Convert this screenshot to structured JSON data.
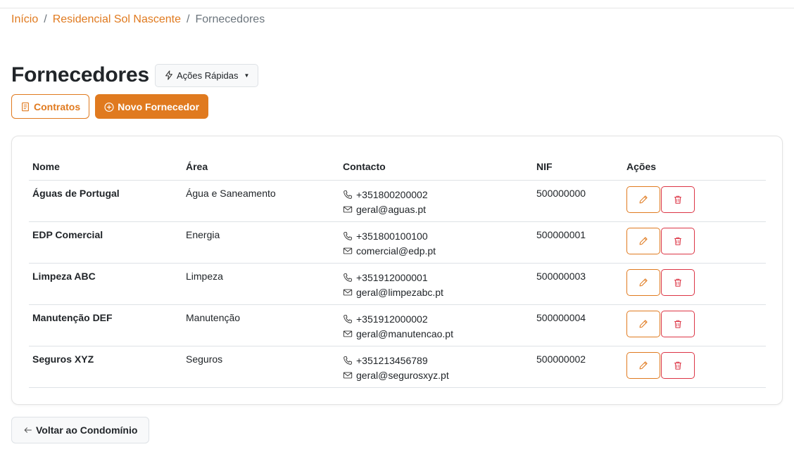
{
  "breadcrumb": {
    "home": "Início",
    "condo": "Residencial Sol Nascente",
    "current": "Fornecedores",
    "separator": "/"
  },
  "page": {
    "title": "Fornecedores",
    "quick_actions_label": "Ações Rápidas"
  },
  "toolbar": {
    "contracts_label": "Contratos",
    "new_supplier_label": "Novo Fornecedor"
  },
  "table": {
    "headers": {
      "name": "Nome",
      "area": "Área",
      "contact": "Contacto",
      "nif": "NIF",
      "actions": "Ações"
    },
    "rows": [
      {
        "name": "Águas de Portugal",
        "area": "Água e Saneamento",
        "phone": "+351800200002",
        "email": "geral@aguas.pt",
        "nif": "500000000"
      },
      {
        "name": "EDP Comercial",
        "area": "Energia",
        "phone": "+351800100100",
        "email": "comercial@edp.pt",
        "nif": "500000001"
      },
      {
        "name": "Limpeza ABC",
        "area": "Limpeza",
        "phone": "+351912000001",
        "email": "geral@limpezabc.pt",
        "nif": "500000003"
      },
      {
        "name": "Manutenção DEF",
        "area": "Manutenção",
        "phone": "+351912000002",
        "email": "geral@manutencao.pt",
        "nif": "500000004"
      },
      {
        "name": "Seguros XYZ",
        "area": "Seguros",
        "phone": "+351213456789",
        "email": "geral@segurosxyz.pt",
        "nif": "500000002"
      }
    ]
  },
  "footer": {
    "back_label": "Voltar ao Condomínio"
  },
  "colors": {
    "accent": "#e07a1f",
    "danger": "#dc3545",
    "muted": "#6c757d"
  },
  "icons": {
    "quick_actions": "lightning-icon",
    "contracts": "document-icon",
    "new_supplier": "plus-circle-icon",
    "phone": "phone-icon",
    "email": "envelope-icon",
    "edit": "pencil-icon",
    "delete": "trash-icon",
    "back": "arrow-left-icon"
  }
}
